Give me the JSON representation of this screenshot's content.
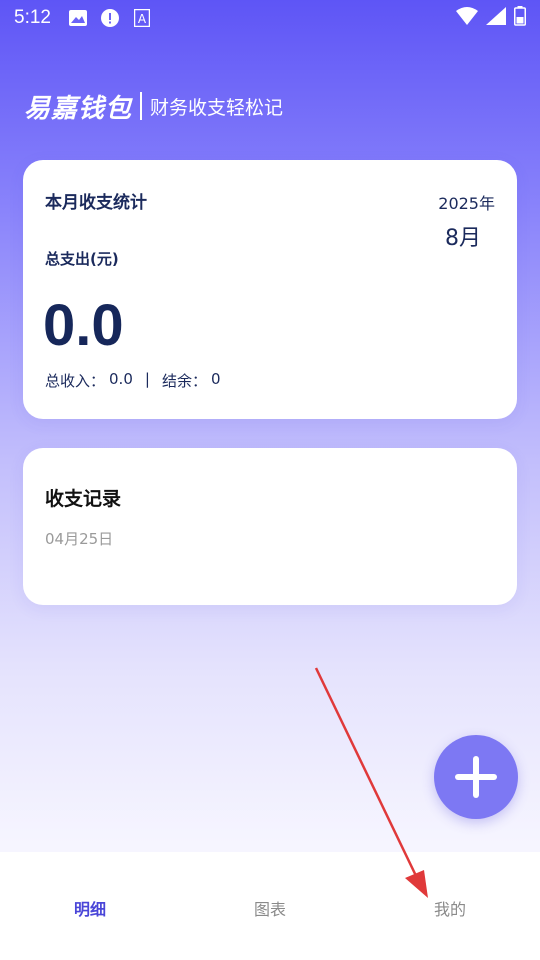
{
  "status_bar": {
    "time": "5:12",
    "left_icons": [
      "image-icon",
      "alert-icon",
      "font-icon"
    ],
    "right_icons": [
      "wifi-icon",
      "signal-icon",
      "battery-icon"
    ]
  },
  "brand": {
    "logo": "易嘉钱包",
    "slogan": "财务收支轻松记"
  },
  "stats": {
    "title": "本月收支统计",
    "year": "2025年",
    "month": "8月",
    "expense_label": "总支出(元)",
    "expense_value": "0.0",
    "income_label": "总收入：",
    "income_value": "0.0",
    "separator": "|",
    "balance_label": "结余：",
    "balance_value": "0"
  },
  "records": {
    "title": "收支记录",
    "date": "04月25日"
  },
  "fab": {
    "icon": "plus-icon"
  },
  "bottom_nav": {
    "items": [
      {
        "label": "明细",
        "active": true
      },
      {
        "label": "图表",
        "active": false
      },
      {
        "label": "我的",
        "active": false
      }
    ]
  },
  "colors": {
    "primary": "#5e55f6",
    "fab": "#7d78f3",
    "active_tab": "#4a46d8",
    "annotation_arrow": "#e0393a"
  }
}
